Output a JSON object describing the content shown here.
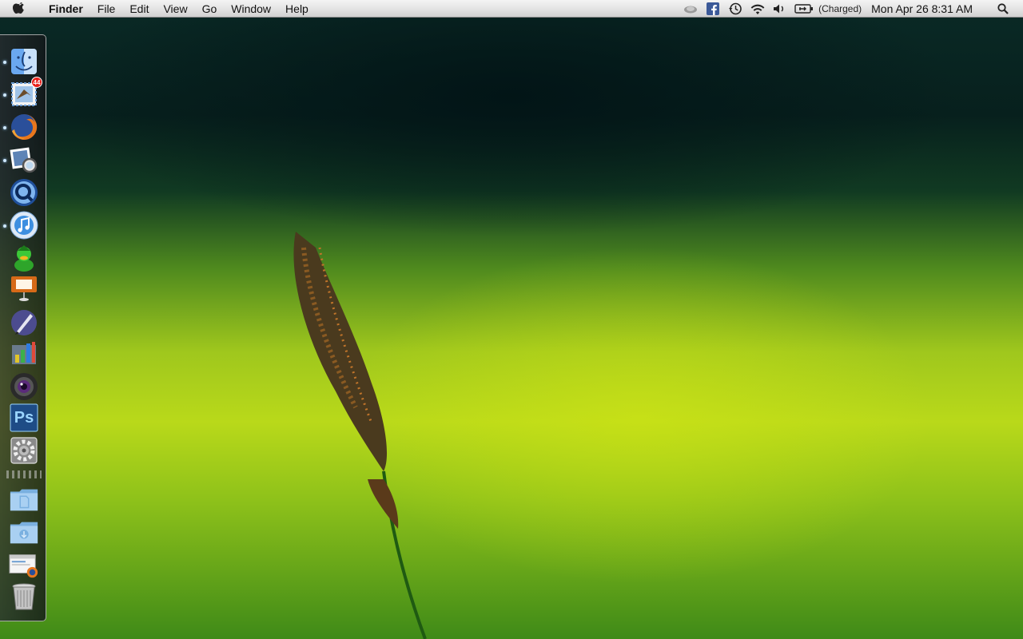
{
  "menubar": {
    "app_name": "Finder",
    "menus": [
      "File",
      "Edit",
      "View",
      "Go",
      "Window",
      "Help"
    ],
    "battery_status": "(Charged)",
    "clock": "Mon Apr 26  8:31 AM",
    "status_icons": [
      "cloud-icon",
      "facebook-icon",
      "time-machine-icon",
      "wifi-icon",
      "volume-icon",
      "battery-icon",
      "spotlight-icon"
    ]
  },
  "dock": {
    "items": [
      {
        "name": "finder",
        "running": true
      },
      {
        "name": "mail",
        "running": true,
        "badge": "44"
      },
      {
        "name": "firefox",
        "running": true
      },
      {
        "name": "preview",
        "running": true
      },
      {
        "name": "quicktime",
        "running": false
      },
      {
        "name": "itunes",
        "running": true
      },
      {
        "name": "adium",
        "running": false
      },
      {
        "name": "keynote",
        "running": false
      },
      {
        "name": "pen-app",
        "running": false
      },
      {
        "name": "numbers",
        "running": false
      },
      {
        "name": "photo-booth",
        "running": false
      },
      {
        "name": "photoshop",
        "running": false,
        "label": "Ps"
      },
      {
        "name": "system-preferences",
        "running": false
      },
      {
        "name": "documents-folder",
        "running": false
      },
      {
        "name": "downloads-folder",
        "running": false
      },
      {
        "name": "web-document",
        "running": false
      },
      {
        "name": "trash",
        "running": false
      }
    ]
  },
  "colors": {
    "menubar_top": "#f4f4f4",
    "wallpaper_dark": "#07201d",
    "wallpaper_green": "#b9d91a"
  }
}
